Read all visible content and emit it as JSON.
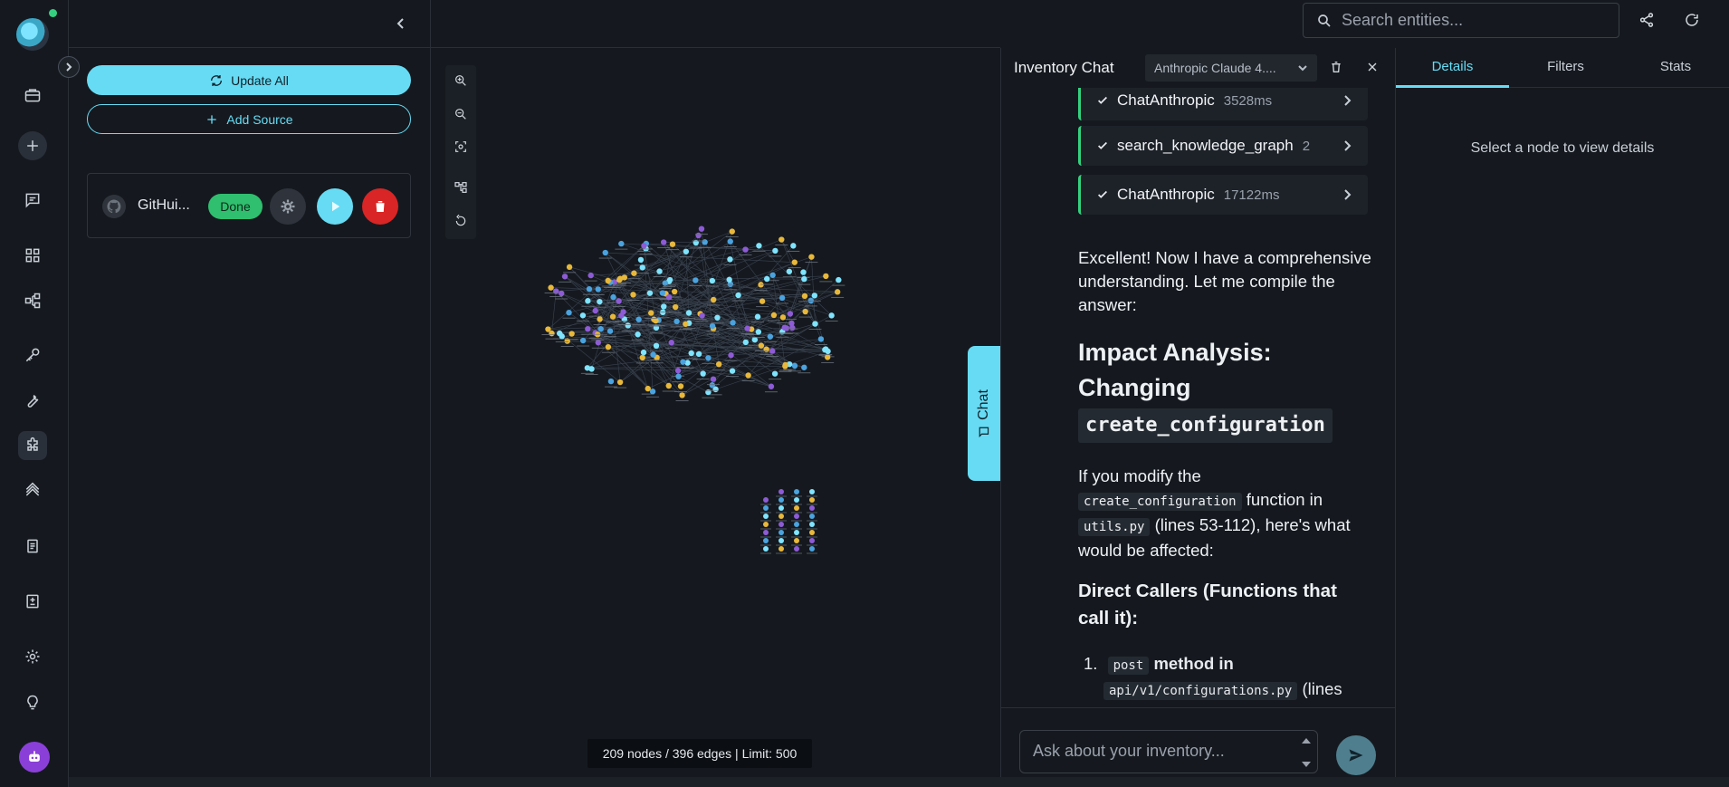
{
  "header": {
    "search_placeholder": "Search entities..."
  },
  "rail": {
    "items": [
      "briefcase-icon",
      "plus-icon",
      "chat-icon",
      "grid-icon",
      "hierarchy-icon",
      "key-icon",
      "wrench-icon",
      "puzzle-icon",
      "layers-icon",
      "documents-icon",
      "report-icon",
      "settings-icon",
      "lightbulb-icon",
      "bot-icon"
    ],
    "active": "puzzle-icon"
  },
  "sources": {
    "update_all_label": "Update All",
    "add_source_label": "Add Source",
    "items": [
      {
        "name": "GitHui...",
        "status": "Done"
      }
    ]
  },
  "graph": {
    "status": "209 nodes / 396 edges | Limit: 500",
    "chat_tab_label": "Chat"
  },
  "chat": {
    "title": "Inventory Chat",
    "model": "Anthropic Claude 4....",
    "tool_calls": [
      {
        "name": "ChatAnthropic",
        "meta": "3528ms"
      },
      {
        "name": "search_knowledge_graph",
        "meta": "2"
      },
      {
        "name": "ChatAnthropic",
        "meta": "17122ms"
      }
    ],
    "intro": "Excellent! Now I have a comprehensive understanding. Let me compile the answer:",
    "heading_text": "Impact Analysis: Changing",
    "heading_code": "create_configuration",
    "para_prefix": "If you modify the",
    "para_code1": "create_configuration",
    "para_mid": "function in",
    "para_code2": "utils.py",
    "para_suffix": "(lines 53-112), here's what would be affected:",
    "subheading": "Direct Callers (Functions that call it):",
    "list_item_number": "1.",
    "list_item_code1": "post",
    "list_item_text": "method in",
    "list_item_code2": "api/v1/configurations.py",
    "list_item_suffix": "(lines",
    "input_placeholder": "Ask about your inventory..."
  },
  "details": {
    "tabs": [
      "Details",
      "Filters",
      "Stats"
    ],
    "active_tab": "Details",
    "empty_message": "Select a node to view details"
  },
  "colors": {
    "accent": "#67dbf3",
    "success": "#2fbf6e",
    "danger": "#d92525",
    "node_yellow": "#e8b83a",
    "node_purple": "#8e5bd6",
    "node_blue": "#4aa3df",
    "node_cyan": "#7fe4ff"
  }
}
